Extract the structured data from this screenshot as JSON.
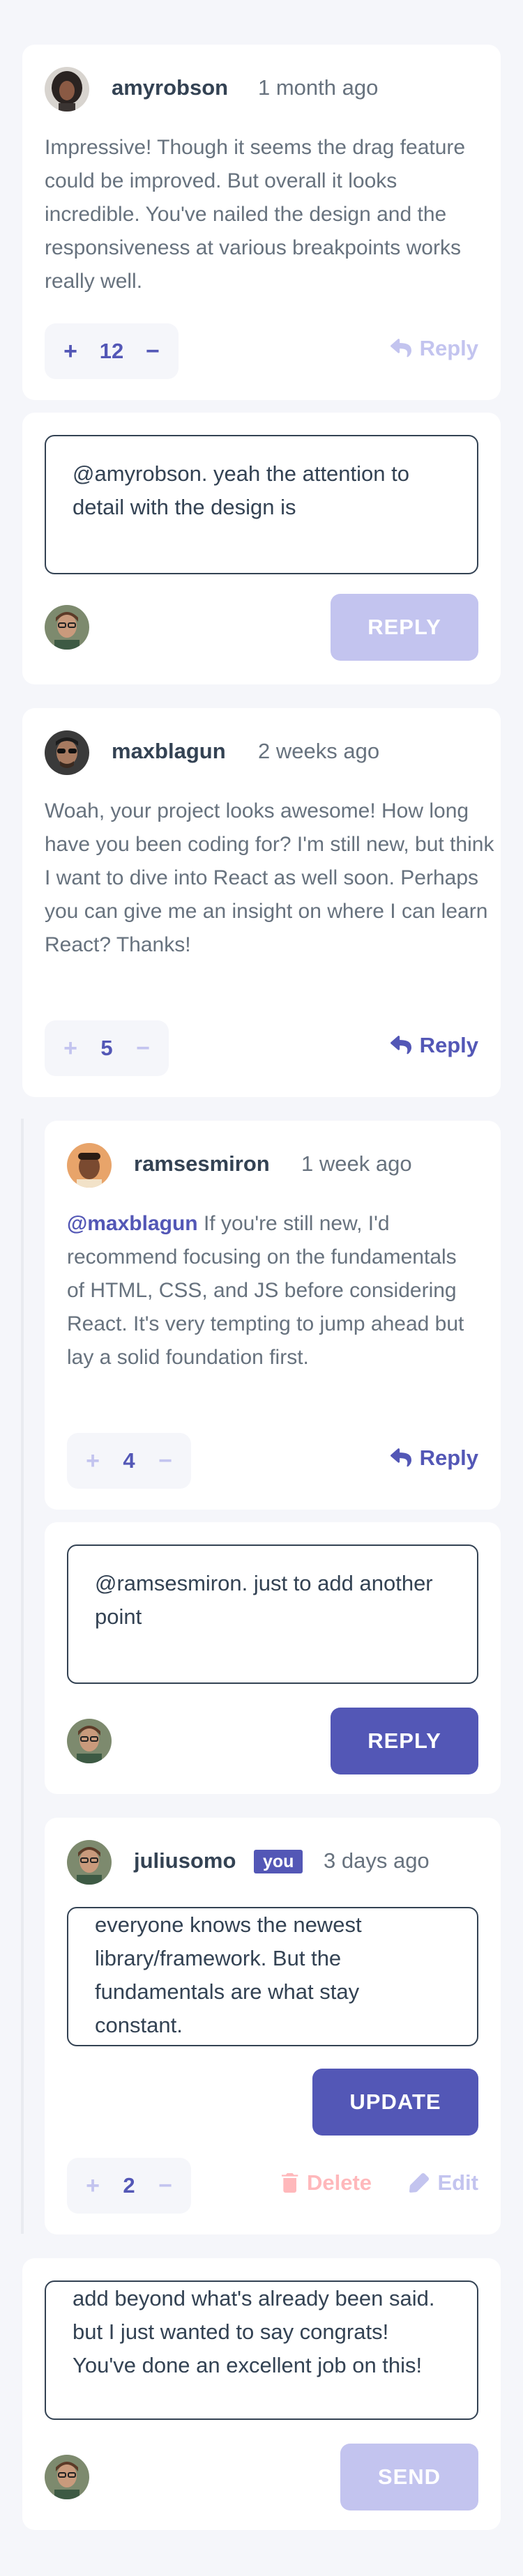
{
  "comments": {
    "amy": {
      "username": "amyrobson",
      "time": "1 month ago",
      "text": "Impressive! Though it seems the drag feature could be improved. But overall it looks incredible. You've nailed the design and the responsiveness at various breakpoints works really well.",
      "score": "12",
      "reply_label": "Reply",
      "avatar_icon": "amyrobson-avatar"
    },
    "amy_reply_box": {
      "value": "@amyrobson. yeah the attention to detail with the design is",
      "button_label": "REPLY"
    },
    "max": {
      "username": "maxblagun",
      "time": "2 weeks ago",
      "text": "Woah, your project looks awesome! How long have you been coding for? I'm still new, but think I want to dive into React as well soon. Perhaps you can give me an insight on where I can learn React? Thanks!",
      "score": "5",
      "reply_label": "Reply"
    },
    "ramses": {
      "username": "ramsesmiron",
      "time": "1 week ago",
      "mention": "@maxblagun",
      "text": "If you're still new, I'd recommend focusing on the fundamentals of HTML, CSS, and JS before considering React. It's very tempting to jump ahead but lay a solid foundation first.",
      "score": "4",
      "reply_label": "Reply"
    },
    "ramses_reply_box": {
      "value": "@ramsesmiron. just to add another point",
      "button_label": "REPLY"
    },
    "julius": {
      "username": "juliusomo",
      "badge": "you",
      "time": "3 days ago",
      "edit_value": "everyone knows the newest library/framework. But the fundamentals are what stay constant.",
      "update_label": "UPDATE",
      "score": "2",
      "delete_label": "Delete",
      "edit_label": "Edit"
    }
  },
  "new_comment": {
    "value": "add beyond what's already been said. but I just wanted to say congrats! You've done an excellent job on this!",
    "button_label": "SEND"
  },
  "colors": {
    "accent": "#5357b6",
    "accent_light": "#c3c4ef",
    "danger": "#ed6368",
    "danger_light": "#ffb8bb",
    "background": "#f5f6fa",
    "text": "#67727e",
    "heading": "#334253"
  }
}
